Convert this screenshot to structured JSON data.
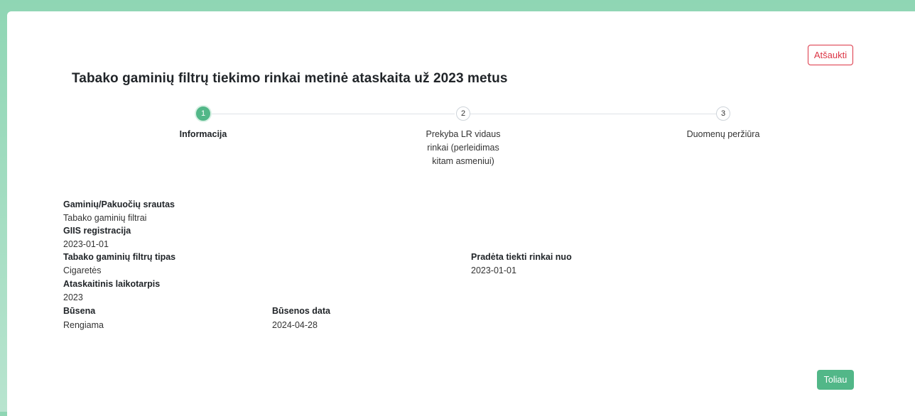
{
  "header": {
    "cancel_label": "Atšaukti",
    "title": "Tabako gaminių filtrų tiekimo rinkai metinė ataskaita už 2023 metus"
  },
  "stepper": {
    "steps": [
      {
        "number": "1",
        "label": "Informacija",
        "active": true
      },
      {
        "number": "2",
        "label_lines": [
          "Prekyba LR vidaus",
          "rinkai (perleidimas",
          "kitam asmeniui)"
        ],
        "active": false
      },
      {
        "number": "3",
        "label": "Duomenų peržiūra",
        "active": false
      }
    ]
  },
  "fields": {
    "flow_label": "Gaminių/Pakuočių srautas",
    "flow_value": "Tabako gaminių filtrai",
    "giis_label": "GIIS registracija",
    "giis_value": "2023-01-01",
    "type_label": "Tabako gaminių filtrų tipas",
    "type_value": "Cigaretės",
    "start_label": "Pradėta tiekti rinkai nuo",
    "start_value": "2023-01-01",
    "period_label": "Ataskaitinis laikotarpis",
    "period_value": "2023",
    "status_label": "Būsena",
    "status_value": "Rengiama",
    "status_date_label": "Būsenos data",
    "status_date_value": "2024-04-28"
  },
  "footer": {
    "next_label": "Toliau"
  },
  "colors": {
    "accent": "#52b788",
    "danger": "#dc3545",
    "background": "#8fd6b4"
  }
}
